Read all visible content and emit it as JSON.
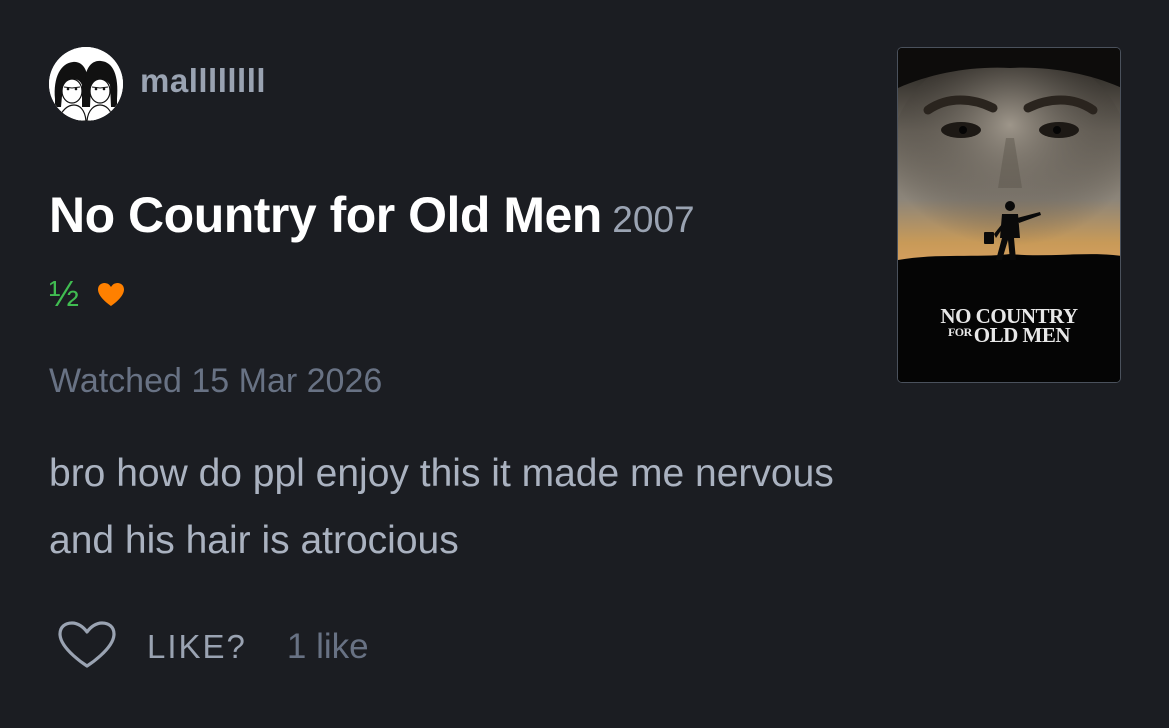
{
  "review": {
    "user": {
      "username": "mallllllll",
      "avatar_icon": "avatar-two-faces"
    },
    "film": {
      "title": "No Country for Old Men",
      "year": "2007",
      "poster": {
        "title_line1": "NO COUNTRY",
        "title_line2_small": "FOR",
        "title_line2": "OLD MEN"
      }
    },
    "rating": "½",
    "liked": true,
    "watched_text": "Watched 15 Mar 2026",
    "body_lines": [
      "bro how do ppl enjoy this it made me nervous",
      "and his hair is atrocious"
    ],
    "actions": {
      "like_label": "LIKE?",
      "like_count": "1 like"
    }
  },
  "colors": {
    "background": "#1b1d22",
    "rating_green": "#40bc51",
    "heart_orange": "#ff8000",
    "muted_text": "#9aa3b2",
    "dim_text": "#687284",
    "body_text": "#aab2c0"
  },
  "icons": {
    "liked": "heart-icon",
    "like_action": "heart-outline-icon"
  }
}
